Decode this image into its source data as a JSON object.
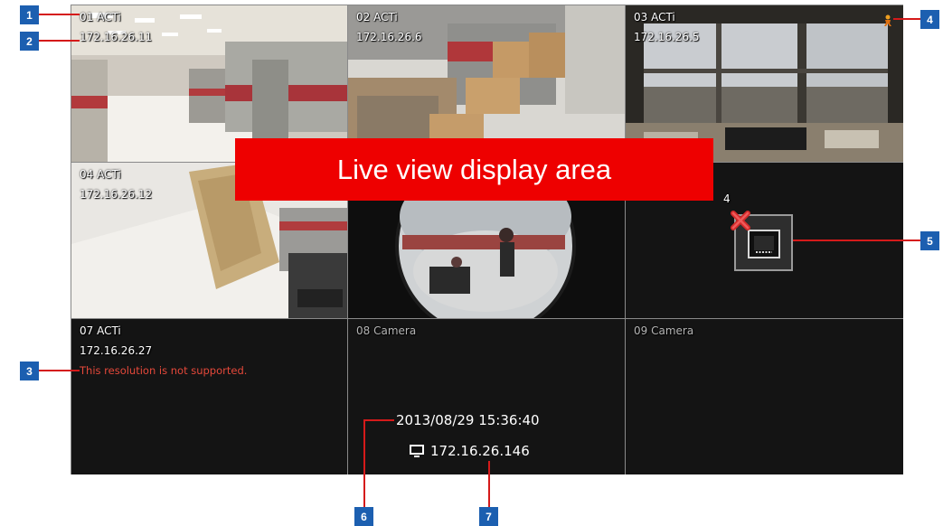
{
  "overlay_label": "Live view display area",
  "cells": [
    {
      "name": "01 ACTi",
      "ip": "172.16.26.11"
    },
    {
      "name": "02 ACTi",
      "ip": "172.16.26.6"
    },
    {
      "name": "03 ACTi",
      "ip": "172.16.26.5"
    },
    {
      "name": "04 ACTi",
      "ip": "172.16.26.12"
    },
    {
      "name": "",
      "ip": ""
    },
    {
      "name": "",
      "ip": "4"
    },
    {
      "name": "07 ACTi",
      "ip": "172.16.26.27",
      "error": "This resolution is not supported."
    },
    {
      "name": "08 Camera"
    },
    {
      "name": "09 Camera"
    }
  ],
  "status": {
    "datetime": "2013/08/29 15:36:40",
    "server_ip": "172.16.26.146"
  },
  "callouts": [
    "1",
    "2",
    "3",
    "4",
    "5",
    "6",
    "7"
  ],
  "icons": {
    "motion": "motion-alert-icon",
    "network": "network-disconnected-icon",
    "monitor": "monitor-icon"
  },
  "colors": {
    "callout": "#1c5fb0",
    "leader": "#d51a1a",
    "overlay": "#ee0000",
    "error_text": "#e5483a"
  }
}
